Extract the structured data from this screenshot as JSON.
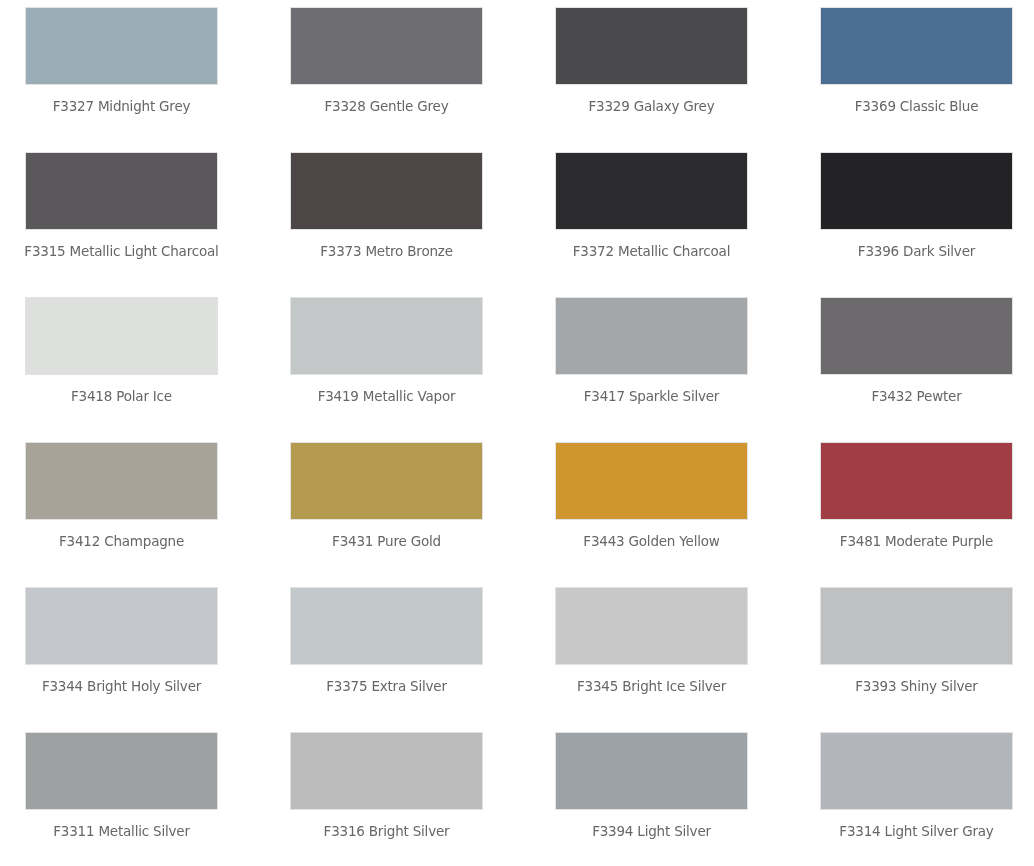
{
  "swatches": [
    {
      "label": "F3327 Midnight Grey",
      "color": "#9aacb5"
    },
    {
      "label": "F3328 Gentle Grey",
      "color": "#6e6e72"
    },
    {
      "label": "F3329 Galaxy Grey",
      "color": "#4a494c"
    },
    {
      "label": "F3369 Classic Blue",
      "color": "#4a6f92"
    },
    {
      "label": "F3315 Metallic Light Charcoal",
      "color": "#5a585a"
    },
    {
      "label": "F3373 Metro Bronze",
      "color": "#4c4647"
    },
    {
      "label": "F3372 Metallic Charcoal",
      "color": "#2c2c2e"
    },
    {
      "label": "F3396 Dark Silver",
      "color": "#232325"
    },
    {
      "label": "F3418 Polar Ice",
      "color": "#dde0dc"
    },
    {
      "label": "F3419 Metallic Vapor",
      "color": "#c5c8c8"
    },
    {
      "label": "F3417 Sparkle Silver",
      "color": "#a4a7aa"
    },
    {
      "label": "F3432 Pewter",
      "color": "#6c6a6c"
    },
    {
      "label": "F3412 Champagne",
      "color": "#a8a398"
    },
    {
      "label": "F3431 Pure Gold",
      "color": "#b49a4f"
    },
    {
      "label": "F3443 Golden Yellow",
      "color": "#cf952f"
    },
    {
      "label": "F3481 Moderate Purple",
      "color": "#a13d45"
    },
    {
      "label": "F3344 Bright Holy Silver",
      "color": "#c4c8cc"
    },
    {
      "label": "F3375 Extra Silver",
      "color": "#c3c8cb"
    },
    {
      "label": "F3345 Bright Ice Silver",
      "color": "#c8c8c8"
    },
    {
      "label": "F3393 Shiny Silver",
      "color": "#bfc0c2"
    },
    {
      "label": "F3311 Metallic Silver",
      "color": "#9da1a2"
    },
    {
      "label": "F3316 Bright Silver",
      "color": "#bcbcbc"
    },
    {
      "label": "F3394 Light Silver",
      "color": "#9da2a7"
    },
    {
      "label": "F3314 Light Silver Gray",
      "color": "#b2b6ba"
    }
  ]
}
